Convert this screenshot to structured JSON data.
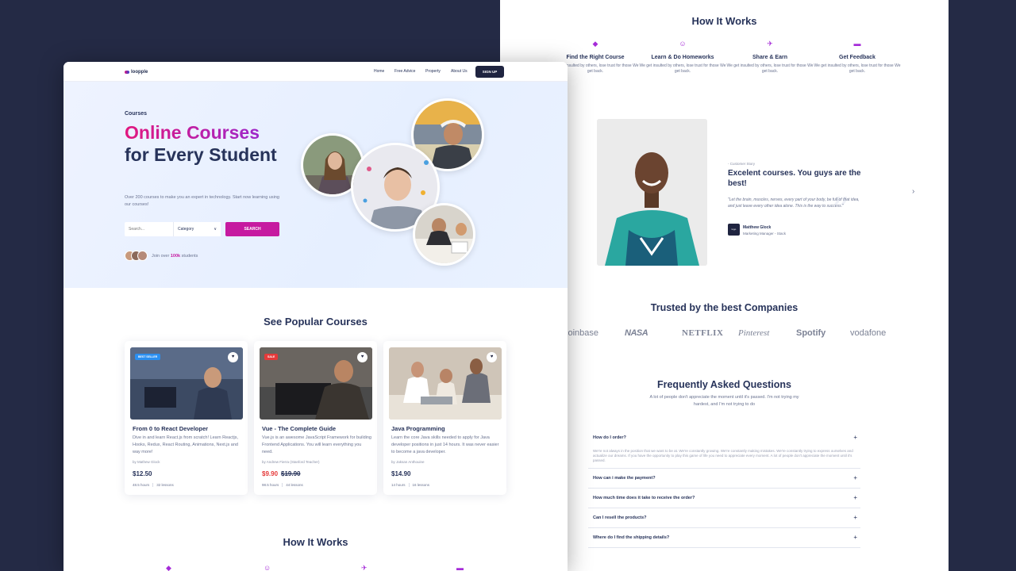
{
  "back_page": {
    "how_it_works": {
      "title": "How It Works",
      "steps": [
        {
          "icon": "box-icon",
          "title": "Find the Right Course",
          "desc": "We get insulted by others, lose trust for those We get back."
        },
        {
          "icon": "users-icon",
          "title": "Learn & Do Homeworks",
          "desc": "We get insulted by others, lose trust for those We get back."
        },
        {
          "icon": "rocket-icon",
          "title": "Share & Earn",
          "desc": "We get insulted by others, lose trust for those We get back."
        },
        {
          "icon": "credit-card-icon",
          "title": "Get Feedback",
          "desc": "We get insulted by others, lose trust for those We get back."
        }
      ]
    },
    "story": {
      "label": "- Customer Story",
      "title": "Excelent courses. You guys are the best!",
      "quote": "\"Let the brain, muscles, nerves, every part of your body, be full of that idea, and just leave every other idea alone. This is the way to success.\"",
      "author": "Matthew Glock",
      "role": "Marketing Manager - Stack",
      "logo_text": "logo"
    },
    "trusted": {
      "title": "Trusted by the best Companies",
      "brands": [
        "coinbase",
        "NASA",
        "NETFLIX",
        "Pinterest",
        "Spotify",
        "vodafone"
      ]
    },
    "faq": {
      "title": "Frequently Asked Questions",
      "subtitle": "A lot of people don't appreciate the moment until it's passed. I'm not trying my hardest, and I'm not trying to do",
      "items": [
        {
          "q": "How do I order?",
          "a": "We're not always in the position that we want to be at. We're constantly growing. We're constantly making mistakes. We're constantly trying to express ourselves and actualize our dreams. If you have the opportunity to play this game of life you need to appreciate every moment. A lot of people don't appreciate the moment until it's passed."
        },
        {
          "q": "How can i make the payment?"
        },
        {
          "q": "How much time does it take to receive the order?"
        },
        {
          "q": "Can I resell the products?"
        },
        {
          "q": "Where do I find the shipping details?"
        }
      ]
    }
  },
  "front_page": {
    "nav": {
      "logo": "loopple",
      "links": [
        "Home",
        "Free Advice",
        "Property",
        "About Us"
      ],
      "signup": "SIGN UP"
    },
    "hero": {
      "kicker": "Courses",
      "title_highlight": "Online Courses",
      "title_rest": "for Every Student",
      "description": "Over 200 courses to make you an expert in technology. Start now learning using our courses!",
      "search_placeholder": "Search...",
      "category": "Category",
      "search_button": "SEARCH",
      "join_prefix": "Join over",
      "join_count": "100k",
      "join_suffix": "students"
    },
    "popular": {
      "title": "See Popular Courses",
      "courses": [
        {
          "badge": "BEST SELLER",
          "title": "From 0 to React Developer",
          "desc": "Dive in and learn React.js from scratch! Learn Reactjs, Hooks, Redux, React Routing, Animations, Next.js and way more!",
          "author": "by Mathew Glock",
          "price": "$12.50",
          "old_price": "",
          "hours": "48.5 hours",
          "lessons": "32 lessons"
        },
        {
          "badge": "SALE",
          "title": "Vue - The Complete Guide",
          "desc": "Vue.js is an awesome JavaScript Framework for building Frontend Applications. You will learn everything you need.",
          "author": "by Andrew Fierra (Stanford Teacher)",
          "price": "$9.90",
          "old_price": "$19.90",
          "hours": "98.5 hours",
          "lessons": "44 lessons"
        },
        {
          "badge": "",
          "title": "Java Programming",
          "desc": "Learn the core Java skills needed to apply for Java developer positions in just 14 hours. It was never easier to become a java developer.",
          "author": "by Jaksan Anthouine",
          "price": "$14.90",
          "old_price": "",
          "hours": "14 hours",
          "lessons": "16 lessons"
        }
      ]
    },
    "how_it_works_title": "How It Works"
  },
  "colors": {
    "background": "#242a45",
    "navy": "#27335a",
    "accent_magenta": "#c61aa0",
    "accent_purple": "#8a2be0",
    "badge_blue": "#2b8ff0",
    "sale_red": "#e53a3a"
  }
}
